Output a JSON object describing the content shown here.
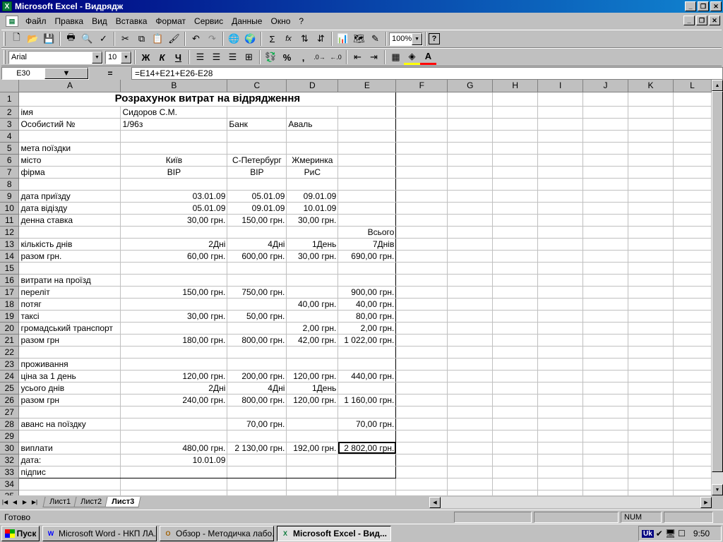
{
  "window": {
    "title": "Microsoft Excel - Видрядж",
    "app_icon": "X"
  },
  "menu": [
    "Файл",
    "Правка",
    "Вид",
    "Вставка",
    "Формат",
    "Сервис",
    "Данные",
    "Окно",
    "?"
  ],
  "toolbar": {
    "zoom": "100%",
    "font_name": "Arial",
    "font_size": "10",
    "bold": "Ж",
    "italic": "К",
    "underline": "Ч",
    "sigma": "Σ",
    "fx": "fx",
    "percent": "%",
    "comma": ",",
    "help": "?"
  },
  "formula_bar": {
    "cell_ref": "E30",
    "equals": "=",
    "formula": "=E14+E21+E26-E28"
  },
  "columns": [
    "A",
    "B",
    "C",
    "D",
    "E",
    "F",
    "G",
    "H",
    "I",
    "J",
    "K",
    "L"
  ],
  "rows": [
    {
      "n": "1",
      "A": "Розрахунок витрат на відрядження",
      "B": "",
      "C": "",
      "D": "",
      "E": ""
    },
    {
      "n": "2",
      "A": "імя",
      "B": "Сидоров С.М.",
      "C": "",
      "D": "",
      "E": ""
    },
    {
      "n": "3",
      "A": "Особистий №",
      "B": "1/96з",
      "C": "Банк",
      "D": "Аваль",
      "E": ""
    },
    {
      "n": "4",
      "A": "",
      "B": "",
      "C": "",
      "D": "",
      "E": ""
    },
    {
      "n": "5",
      "A": "мета поїздки",
      "B": "",
      "C": "",
      "D": "",
      "E": ""
    },
    {
      "n": "6",
      "A": "місто",
      "B": "Київ",
      "C": "С-Петербург",
      "D": "Жмеринка",
      "E": ""
    },
    {
      "n": "7",
      "A": "фірма",
      "B": "ВІР",
      "C": "ВІР",
      "D": "РиС",
      "E": ""
    },
    {
      "n": "8",
      "A": "",
      "B": "",
      "C": "",
      "D": "",
      "E": ""
    },
    {
      "n": "9",
      "A": "дата приїзду",
      "B": "03.01.09",
      "C": "05.01.09",
      "D": "09.01.09",
      "E": ""
    },
    {
      "n": "10",
      "A": "дата відізду",
      "B": "05.01.09",
      "C": "09.01.09",
      "D": "10.01.09",
      "E": ""
    },
    {
      "n": "11",
      "A": "денна ставка",
      "B": "30,00 грн.",
      "C": "150,00 грн.",
      "D": "30,00 грн.",
      "E": ""
    },
    {
      "n": "12",
      "A": "",
      "B": "",
      "C": "",
      "D": "",
      "E": "Всього"
    },
    {
      "n": "13",
      "A": "кількість днів",
      "B": "2Дні",
      "C": "4Дні",
      "D": "1День",
      "E": "7Днів"
    },
    {
      "n": "14",
      "A": "разом грн.",
      "B": "60,00 грн.",
      "C": "600,00 грн.",
      "D": "30,00 грн.",
      "E": "690,00 грн."
    },
    {
      "n": "15",
      "A": "",
      "B": "",
      "C": "",
      "D": "",
      "E": ""
    },
    {
      "n": "16",
      "A": "витрати на проїзд",
      "B": "",
      "C": "",
      "D": "",
      "E": ""
    },
    {
      "n": "17",
      "A": "переліт",
      "B": "150,00 грн.",
      "C": "750,00 грн.",
      "D": "",
      "E": "900,00 грн."
    },
    {
      "n": "18",
      "A": "потяг",
      "B": "",
      "C": "",
      "D": "40,00 грн.",
      "E": "40,00 грн."
    },
    {
      "n": "19",
      "A": "таксі",
      "B": "30,00 грн.",
      "C": "50,00 грн.",
      "D": "",
      "E": "80,00 грн."
    },
    {
      "n": "20",
      "A": "громадський транспорт",
      "B": "",
      "C": "",
      "D": "2,00 грн.",
      "E": "2,00 грн."
    },
    {
      "n": "21",
      "A": "разом грн",
      "B": "180,00 грн.",
      "C": "800,00 грн.",
      "D": "42,00 грн.",
      "E": "1 022,00 грн."
    },
    {
      "n": "22",
      "A": "",
      "B": "",
      "C": "",
      "D": "",
      "E": ""
    },
    {
      "n": "23",
      "A": "проживання",
      "B": "",
      "C": "",
      "D": "",
      "E": ""
    },
    {
      "n": "24",
      "A": "ціна за 1 день",
      "B": "120,00 грн.",
      "C": "200,00 грн.",
      "D": "120,00 грн.",
      "E": "440,00 грн."
    },
    {
      "n": "25",
      "A": "усього днів",
      "B": "2Дні",
      "C": "4Дні",
      "D": "1День",
      "E": ""
    },
    {
      "n": "26",
      "A": "разом грн",
      "B": "240,00 грн.",
      "C": "800,00 грн.",
      "D": "120,00 грн.",
      "E": "1 160,00 грн."
    },
    {
      "n": "27",
      "A": "",
      "B": "",
      "C": "",
      "D": "",
      "E": ""
    },
    {
      "n": "28",
      "A": "аванс на поїздку",
      "B": "",
      "C": "70,00 грн.",
      "D": "",
      "E": "70,00 грн."
    },
    {
      "n": "29",
      "A": "",
      "B": "",
      "C": "",
      "D": "",
      "E": ""
    },
    {
      "n": "30",
      "A": "виплати",
      "B": "480,00 грн.",
      "C": "2 130,00 грн.",
      "D": "192,00 грн.",
      "E": "2 802,00 грн."
    },
    {
      "n": "32",
      "A": "дата:",
      "B": "10.01.09",
      "C": "",
      "D": "",
      "E": ""
    },
    {
      "n": "33",
      "A": "підпис",
      "B": "",
      "C": "",
      "D": "",
      "E": ""
    },
    {
      "n": "34",
      "A": "",
      "B": "",
      "C": "",
      "D": "",
      "E": ""
    },
    {
      "n": "35",
      "A": "",
      "B": "",
      "C": "",
      "D": "",
      "E": ""
    }
  ],
  "sheets": [
    {
      "label": "Лист1",
      "active": false
    },
    {
      "label": "Лист2",
      "active": false
    },
    {
      "label": "Лист3",
      "active": true
    }
  ],
  "status": {
    "ready": "Готово",
    "num": "NUM"
  },
  "taskbar": {
    "start": "Пуск",
    "tasks": [
      {
        "label": "Microsoft Word - НКП ЛА...",
        "icon": "W",
        "active": false
      },
      {
        "label": "Обзор - Методичка лабо...",
        "icon": "O",
        "active": false
      },
      {
        "label": "Microsoft Excel - Вид...",
        "icon": "X",
        "active": true
      }
    ],
    "lang": "Uk",
    "clock": "9:50"
  }
}
